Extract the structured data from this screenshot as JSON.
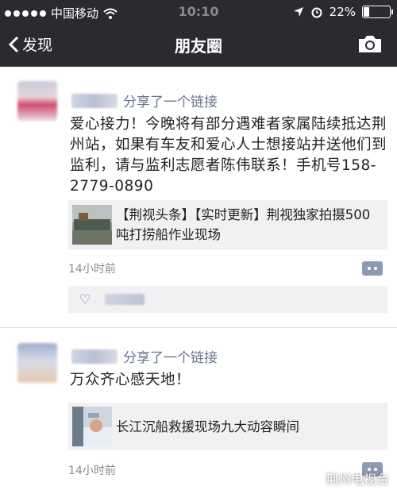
{
  "status_bar": {
    "carrier": "中国移动",
    "time": "10:10",
    "battery": "22%",
    "battery_level": 0.22
  },
  "nav": {
    "back_label": "发现",
    "title": "朋友圈"
  },
  "posts": [
    {
      "action": "分享了一个链接",
      "text": "爱心接力！今晚将有部分遇难者家属陆续抵达荆州站，如果有车友和爱心人士想接站并送他们到监利，请与监利志愿者陈伟联系！手机号158-2779-0890",
      "link_title": "【荆视头条】【实时更新】荆视独家拍摄500吨打捞船作业现场",
      "time": "14小时前"
    },
    {
      "action": "分享了一个链接",
      "text": "万众齐心感天地！",
      "link_title": "长江沉船救援现场九大动容瞬间",
      "time": "14小时前"
    }
  ],
  "watermark": "荆州电视台"
}
